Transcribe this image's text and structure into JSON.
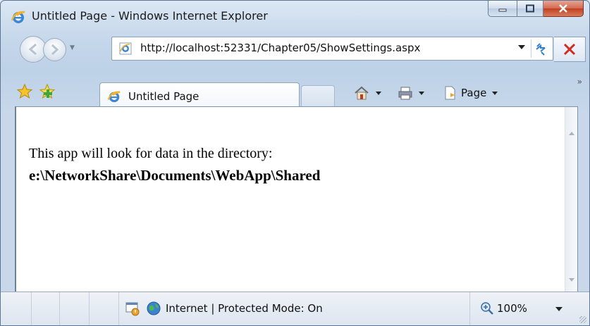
{
  "window": {
    "title": "Untitled Page - Windows Internet Explorer"
  },
  "address_bar": {
    "url": "http://localhost:52331/Chapter05/ShowSettings.aspx"
  },
  "tabs": [
    {
      "label": "Untitled Page"
    }
  ],
  "toolbar": {
    "page_label": "Page"
  },
  "content": {
    "line1": "This app will look for data in the directory:",
    "line2": "e:\\NetworkShare\\Documents\\WebApp\\Shared"
  },
  "status_bar": {
    "zone_text": "Internet | Protected Mode: On",
    "zoom": "100%"
  }
}
